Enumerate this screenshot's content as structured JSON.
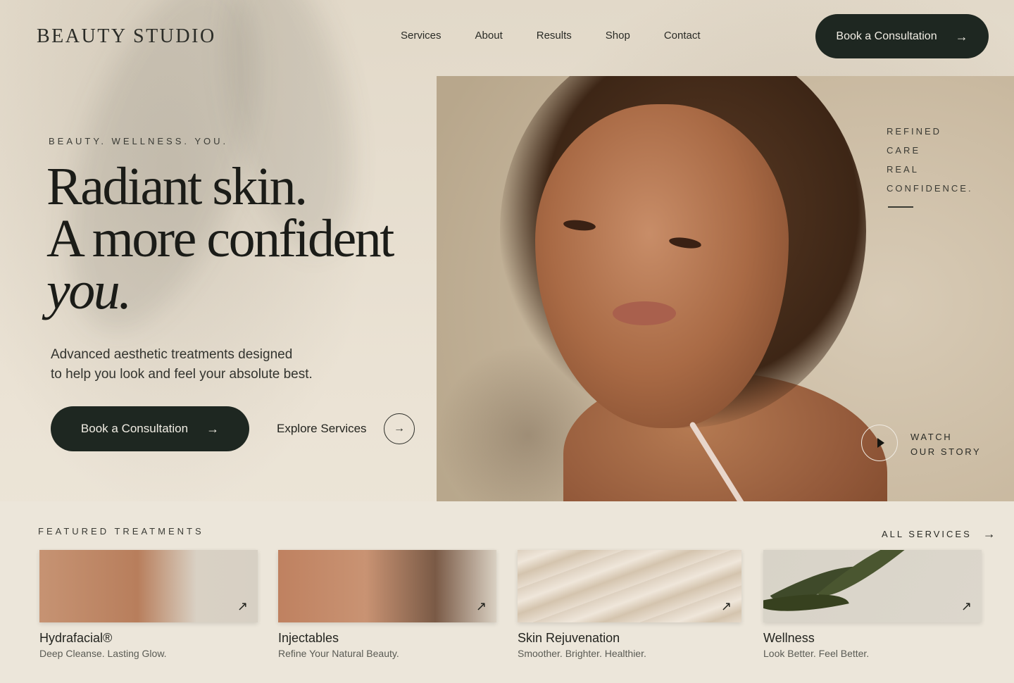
{
  "header": {
    "brand": "BEAUTY STUDIO",
    "nav": [
      "Services",
      "About",
      "Results",
      "Shop",
      "Contact"
    ],
    "cta_label": "Book a Consultation"
  },
  "hero": {
    "eyebrow": "BEAUTY. WELLNESS. YOU.",
    "headline_line1": "Radiant skin.",
    "headline_line2": "A more confident",
    "headline_line3": "you.",
    "subcopy_line1": "Advanced aesthetic treatments designed",
    "subcopy_line2": "to help you look and feel your absolute best.",
    "primary_cta": "Book a Consultation",
    "secondary_cta": "Explore Services",
    "tagline": [
      "REFINED",
      "CARE",
      "REAL",
      "CONFIDENCE."
    ],
    "watch_line1": "WATCH",
    "watch_line2": "OUR STORY"
  },
  "featured": {
    "label": "FEATURED TREATMENTS",
    "all_label": "ALL SERVICES",
    "cards": [
      {
        "title": "Hydrafacial®",
        "subtitle": "Deep Cleanse. Lasting Glow."
      },
      {
        "title": "Injectables",
        "subtitle": "Refine Your Natural Beauty."
      },
      {
        "title": "Skin Rejuvenation",
        "subtitle": "Smoother. Brighter. Healthier."
      },
      {
        "title": "Wellness",
        "subtitle": "Look Better. Feel Better."
      }
    ]
  },
  "icons": {
    "arrow": "arrow-right-icon",
    "diagonal": "arrow-up-right-icon",
    "play": "play-icon"
  },
  "colors": {
    "primary_dark": "#1e2721",
    "background": "#e9e1d3"
  }
}
